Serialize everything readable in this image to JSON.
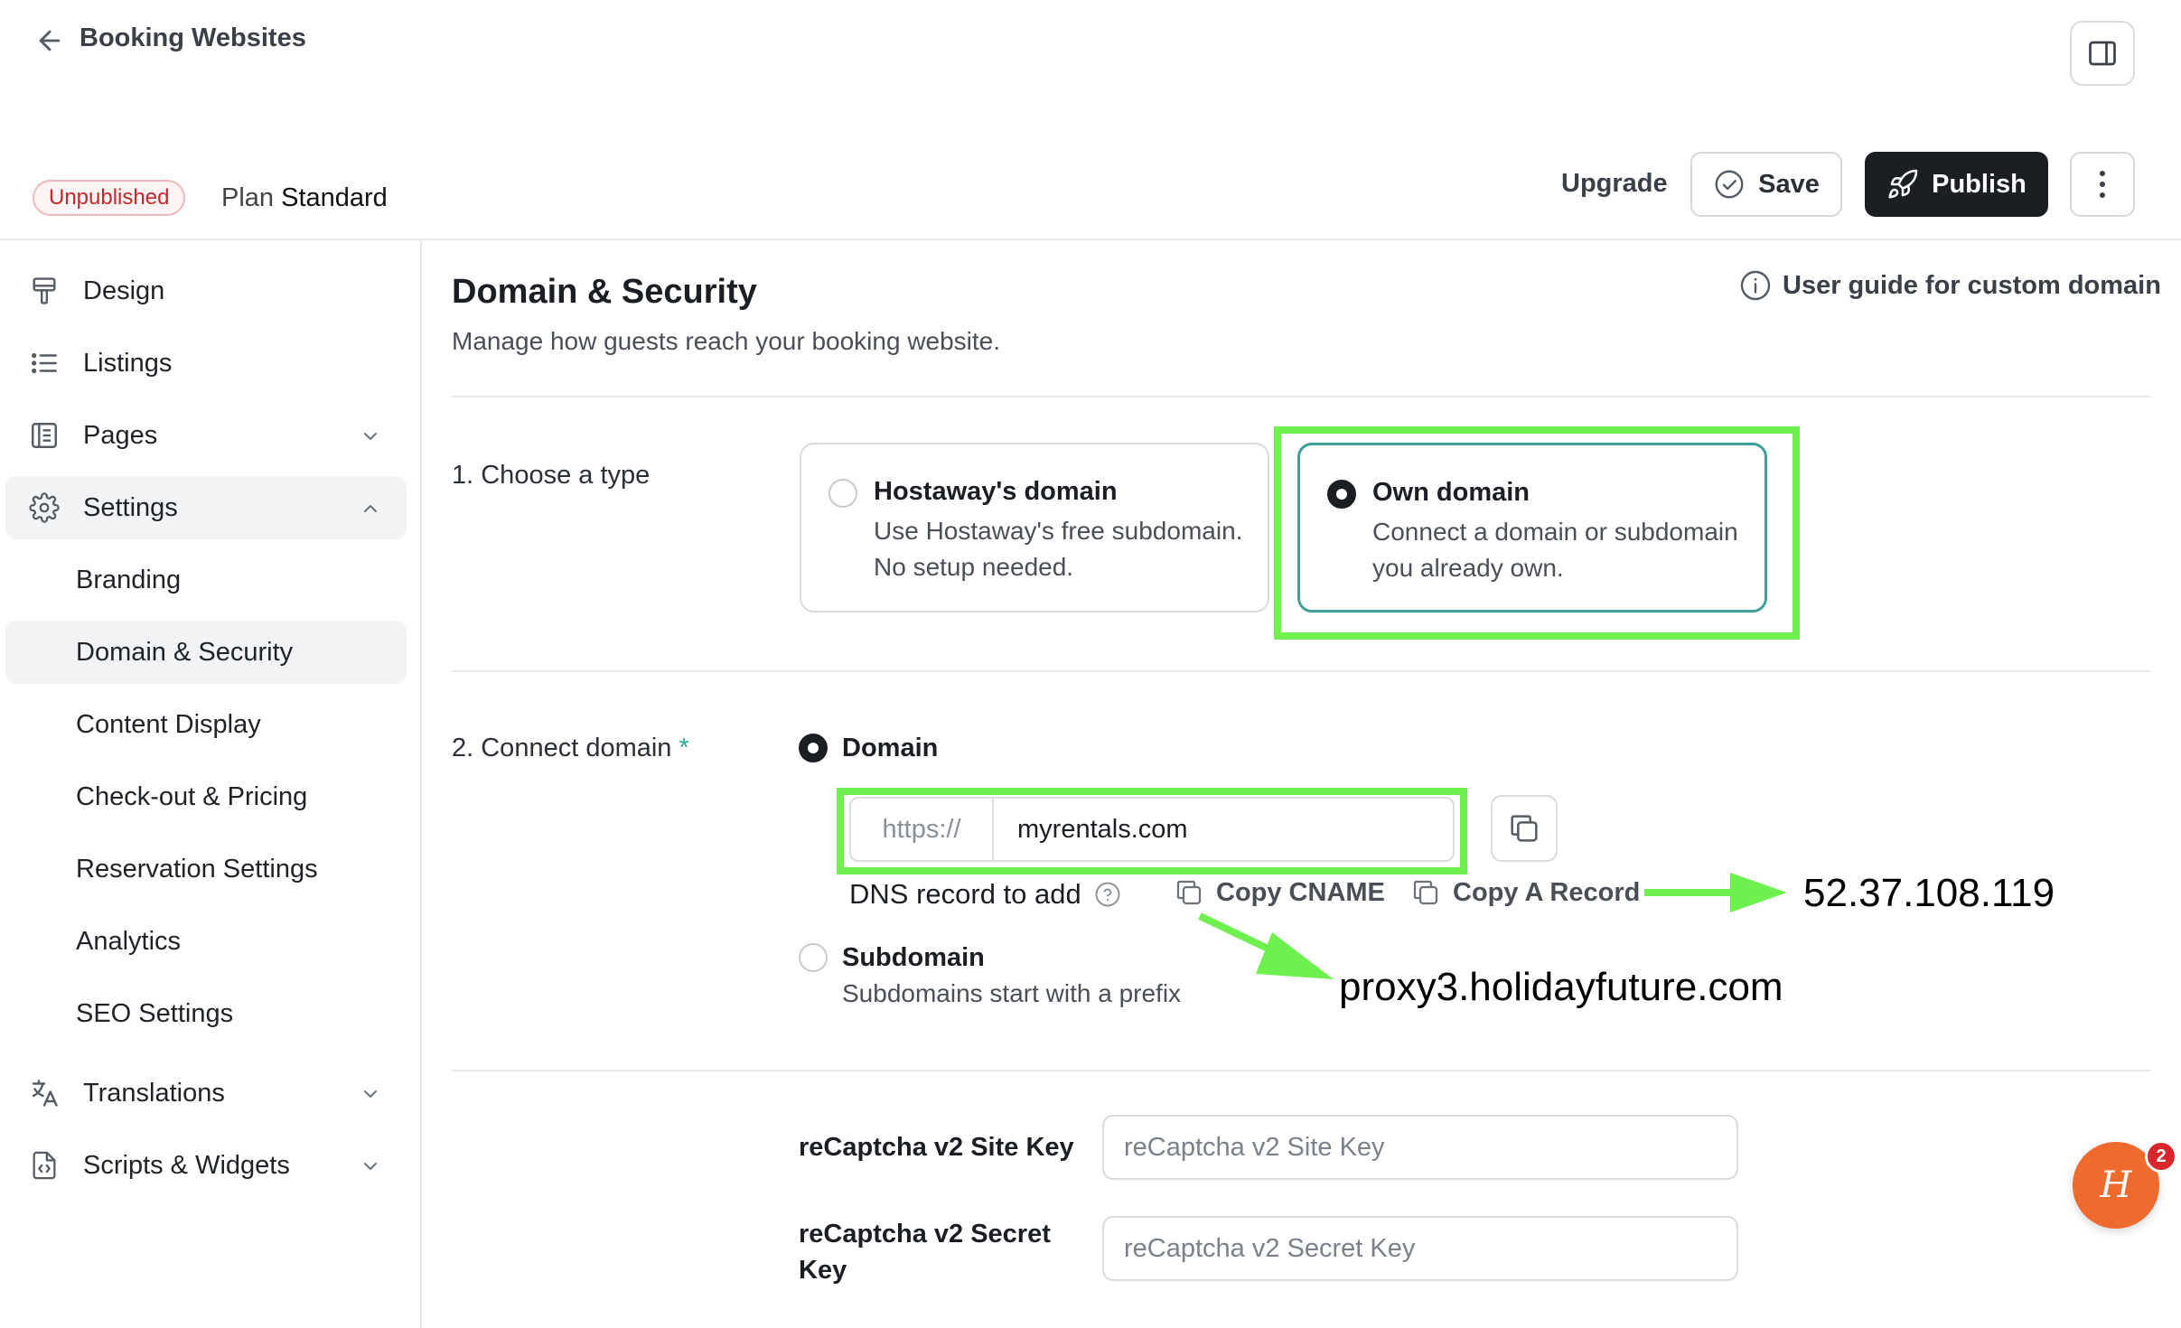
{
  "header": {
    "back_label": "Booking Websites",
    "status_badge": "Unpublished",
    "plan_label": "Plan",
    "plan_value": "Standard",
    "upgrade_label": "Upgrade",
    "save_label": "Save",
    "publish_label": "Publish"
  },
  "sidebar": {
    "items": [
      {
        "label": "Design",
        "icon": "paint-roller-icon"
      },
      {
        "label": "Listings",
        "icon": "list-icon"
      },
      {
        "label": "Pages",
        "icon": "pages-icon"
      },
      {
        "label": "Settings",
        "icon": "gear-icon"
      },
      {
        "label": "Translations",
        "icon": "translate-icon"
      },
      {
        "label": "Scripts & Widgets",
        "icon": "code-file-icon"
      }
    ],
    "settings_sub": [
      "Branding",
      "Domain & Security",
      "Content Display",
      "Check-out & Pricing",
      "Reservation Settings",
      "Analytics",
      "SEO Settings"
    ]
  },
  "main": {
    "title": "Domain & Security",
    "subtitle": "Manage how guests reach your booking website.",
    "guide_link": "User guide for custom domain",
    "step1": {
      "label": "1. Choose a type",
      "options": [
        {
          "title": "Hostaway's domain",
          "desc": "Use Hostaway's free subdomain. No setup needed.",
          "selected": false
        },
        {
          "title": "Own domain",
          "desc": "Connect a domain or subdomain you already own.",
          "selected": true
        }
      ]
    },
    "step2": {
      "label": "2. Connect domain",
      "required_mark": "*",
      "domain_option": "Domain",
      "url_prefix": "https://",
      "url_value": "myrentals.com",
      "dns_label": "DNS record to add",
      "copy_cname": "Copy CNAME",
      "copy_a_record": "Copy A Record",
      "subdomain_option": "Subdomain",
      "subdomain_desc": "Subdomains start with a prefix"
    },
    "recaptcha": {
      "site_key_label": "reCaptcha v2 Site Key",
      "site_key_placeholder": "reCaptcha v2 Site Key",
      "secret_key_label": "reCaptcha v2 Secret Key",
      "secret_key_placeholder": "reCaptcha v2 Secret Key"
    }
  },
  "annotations": {
    "a_record_value": "52.37.108.119",
    "cname_value": "proxy3.holidayfuture.com"
  },
  "chat": {
    "badge_count": "2",
    "logo_glyph": "H"
  },
  "colors": {
    "accent_teal": "#3f9e97",
    "annotation_green": "#6ef04f",
    "publish_bg": "#1b1f24",
    "badge_red": "#c0282b",
    "chat_orange": "#ef6a2d"
  }
}
